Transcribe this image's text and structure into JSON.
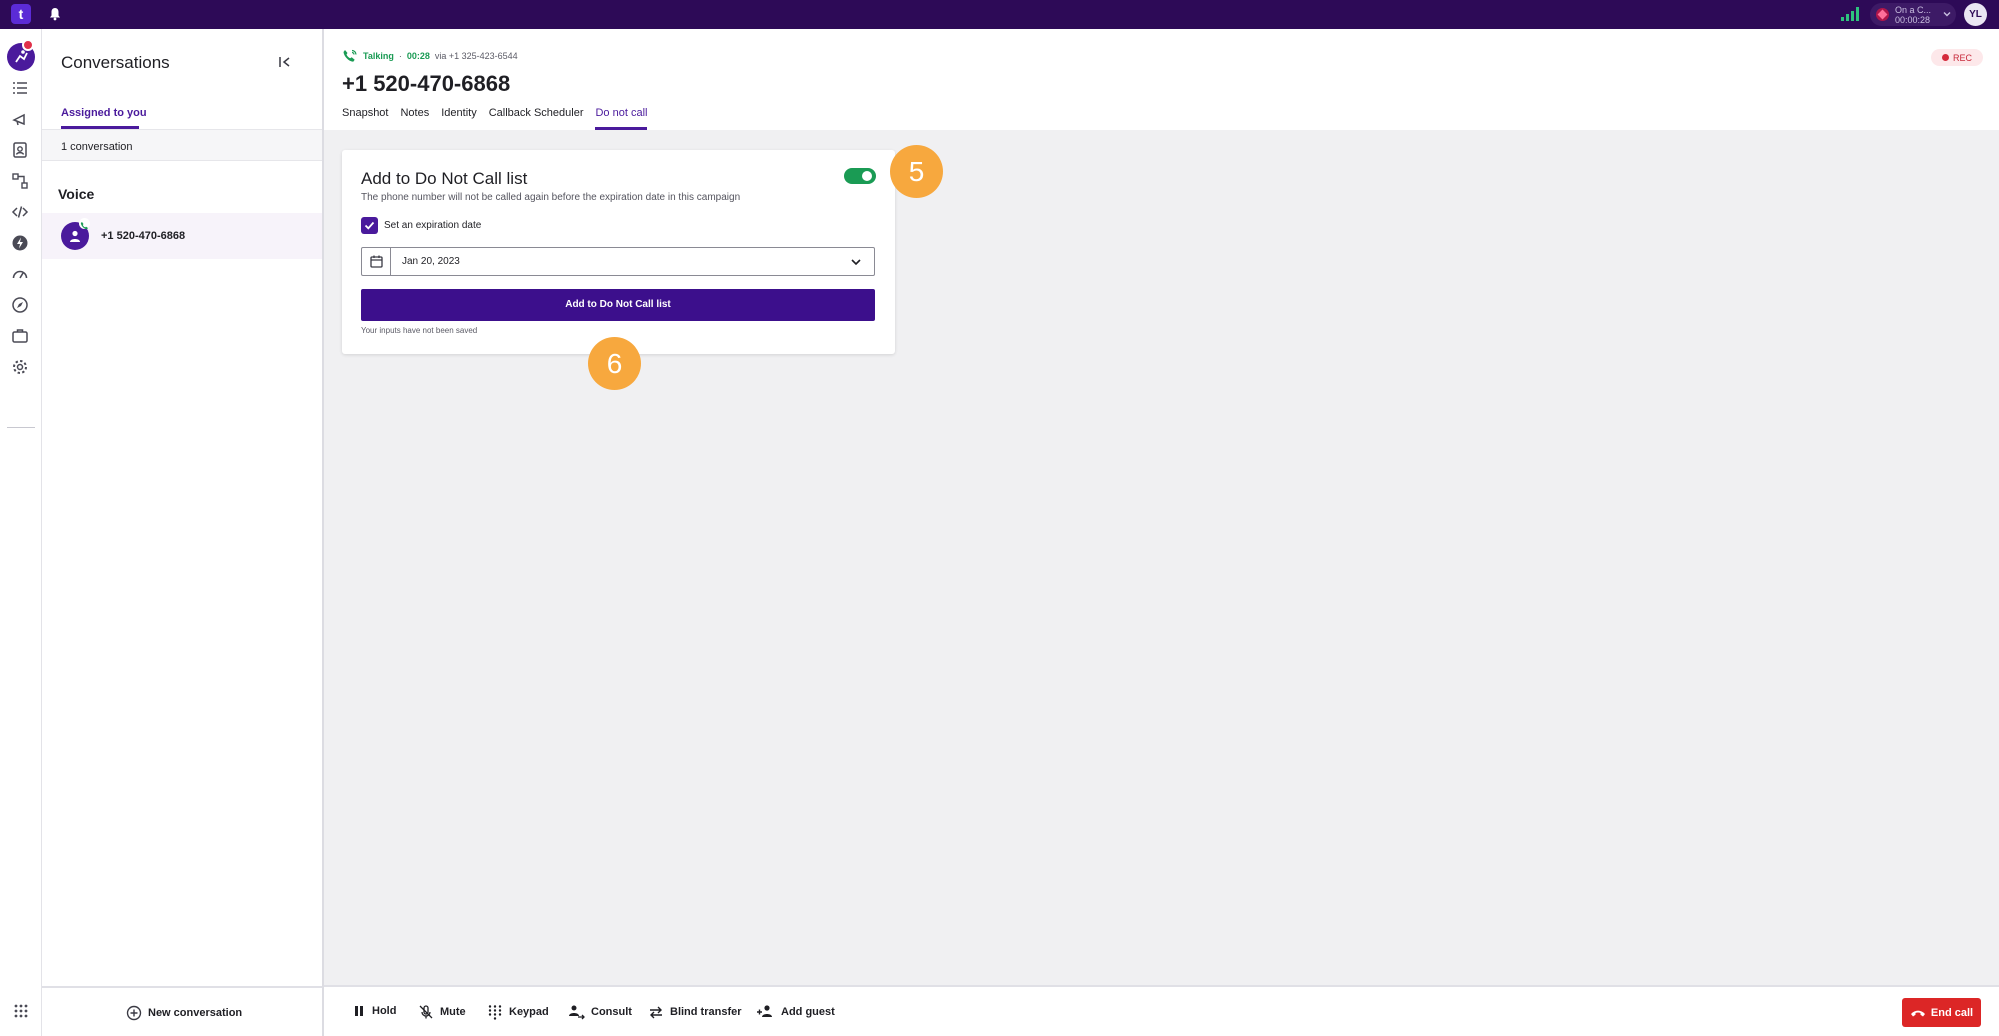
{
  "topbar": {
    "logo_text": "t",
    "status_line1": "On a C...",
    "status_line2": "00:00:28",
    "user_initials": "YL"
  },
  "conversations": {
    "title": "Conversations",
    "tab_label": "Assigned to you",
    "count_text": "1 conversation",
    "section_voice": "Voice",
    "items": [
      {
        "label": "+1 520-470-6868"
      }
    ],
    "new_conversation": "New conversation"
  },
  "call": {
    "status": "Talking",
    "duration": "00:28",
    "via_text": "via +1 325-423-6544",
    "phone": "+1 520-470-6868",
    "rec_label": "REC"
  },
  "tabs": [
    {
      "label": "Snapshot",
      "active": false
    },
    {
      "label": "Notes",
      "active": false
    },
    {
      "label": "Identity",
      "active": false
    },
    {
      "label": "Callback Scheduler",
      "active": false
    },
    {
      "label": "Do not call",
      "active": true
    }
  ],
  "dnc": {
    "title": "Add to Do Not Call list",
    "description": "The phone number will not be called again before the expiration date in this campaign",
    "toggle_on": true,
    "checkbox_label": "Set an expiration date",
    "checkbox_checked": true,
    "date_value": "Jan 20, 2023",
    "button_label": "Add to Do Not Call list",
    "unsaved_note": "Your inputs have not been saved"
  },
  "markers": {
    "m5": "5",
    "m6": "6"
  },
  "controls": {
    "hold": "Hold",
    "mute": "Mute",
    "keypad": "Keypad",
    "consult": "Consult",
    "blind_transfer": "Blind transfer",
    "add_guest": "Add guest",
    "end_call": "End call"
  },
  "colors": {
    "topbar": "#2d0a57",
    "accent": "#4a1a9c",
    "button": "#3c0f8c",
    "toggle": "#1a9b54",
    "end_call": "#dc2626",
    "marker": "#f7a83e"
  }
}
